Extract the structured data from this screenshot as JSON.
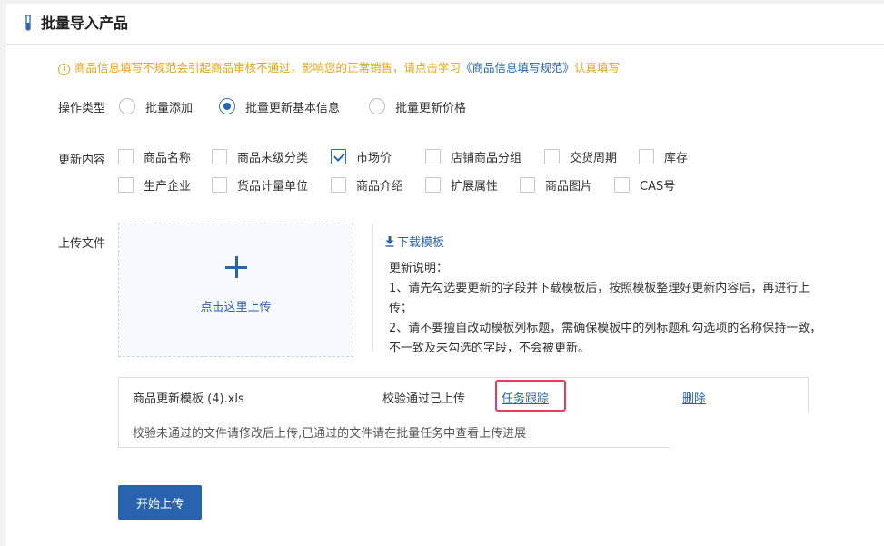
{
  "header": {
    "title": "批量导入产品",
    "icon": "test-tube-icon"
  },
  "notice": {
    "prefix": "商品信息填写不规范会引起商品审核不通过，影响您的正常销售，请点击学习",
    "link": "《商品信息填写规范》",
    "suffix": "认真填写"
  },
  "operation": {
    "label": "操作类型",
    "options": [
      {
        "label": "批量添加",
        "selected": false
      },
      {
        "label": "批量更新基本信息",
        "selected": true
      },
      {
        "label": "批量更新价格",
        "selected": false
      }
    ]
  },
  "update_content": {
    "label": "更新内容",
    "row1": [
      {
        "label": "商品名称",
        "checked": false
      },
      {
        "label": "商品末级分类",
        "checked": false
      },
      {
        "label": "市场价",
        "checked": true
      },
      {
        "label": "店铺商品分组",
        "checked": false
      },
      {
        "label": "交货周期",
        "checked": false
      },
      {
        "label": "库存",
        "checked": false
      }
    ],
    "row2": [
      {
        "label": "生产企业",
        "checked": false
      },
      {
        "label": "货品计量单位",
        "checked": false
      },
      {
        "label": "商品介绍",
        "checked": false
      },
      {
        "label": "扩展属性",
        "checked": false
      },
      {
        "label": "商品图片",
        "checked": false
      },
      {
        "label": "CAS号",
        "checked": false
      }
    ]
  },
  "upload": {
    "label": "上传文件",
    "click_text": "点击这里上传",
    "download_link": "下载模板",
    "notes_title": "更新说明：",
    "note1": "1、请先勾选要更新的字段并下载模板后，按照模板整理好更新内容后，再进行上传；",
    "note2": "2、请不要擅自改动模板列标题，需确保模板中的列标题和勾选项的名称保持一致，不一致及未勾选的字段，不会被更新。"
  },
  "file": {
    "name": "商品更新模板 (4).xls",
    "status": "校验通过已上传",
    "track_link": "任务跟踪",
    "delete_link": "删除",
    "hint": "校验未通过的文件请修改后上传,已通过的文件请在批量任务中查看上传进展"
  },
  "start_button": "开始上传",
  "colors": {
    "accent": "#2a63ad",
    "warning": "#e8a317",
    "highlight": "#ec3b5a"
  }
}
